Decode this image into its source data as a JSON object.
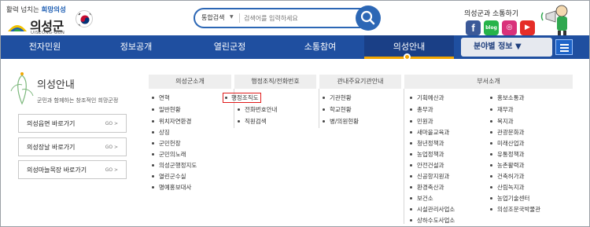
{
  "header": {
    "slogan_prefix": "활력 넘치는 ",
    "slogan_highlight": "희망의성",
    "logo_name": "의성군",
    "logo_sub": "UISEONG-GUN",
    "sns_title": "의성군과 소통하기",
    "sns": {
      "facebook": "f",
      "blog": "blog",
      "instagram": "◎",
      "youtube": "▶"
    }
  },
  "search": {
    "scope": "통합검색",
    "placeholder": "검색어를 입력하세요"
  },
  "nav": {
    "items": [
      "전자민원",
      "정보공개",
      "열린군정",
      "소통참여",
      "의성안내"
    ],
    "active_index": 4,
    "field_info": "분야별 정보 ▼"
  },
  "left_panel": {
    "title": "의성안내",
    "desc": "군민과 함께하는 창조적인 희망군정",
    "buttons": [
      {
        "label": "의성읍면 바로가기",
        "go": "GO >"
      },
      {
        "label": "의성장날 바로가기",
        "go": "GO >"
      },
      {
        "label": "의성마늘목장 바로가기",
        "go": "GO >"
      }
    ]
  },
  "columns": [
    {
      "header": "의성군소개",
      "items": [
        "연혁",
        "일반현황",
        "위치자연환경",
        "상징",
        "군민헌장",
        "군민의노래",
        "의성군행정지도",
        "열린군수실",
        "명예홍보대사"
      ]
    },
    {
      "header": "행정조직/전화번호",
      "items": [
        "행정조직도",
        "전화번호안내",
        "직원검색"
      ],
      "highlight_index": 0
    },
    {
      "header": "관내주요기관안내",
      "items": [
        "기관현황",
        "학교현황",
        "병/의원현황"
      ]
    },
    {
      "header": "부서소개",
      "items_left": [
        "기획예산과",
        "총무과",
        "민원과",
        "새마을교육과",
        "청년정책과",
        "농업정책과",
        "안전건설과",
        "신공항지원과",
        "환경축산과",
        "보건소",
        "시설관리사업소",
        "상하수도사업소"
      ],
      "items_right": [
        "홍보소통과",
        "재무과",
        "복지과",
        "관광문화과",
        "미래산업과",
        "유통정책과",
        "농촌활력과",
        "건축허가과",
        "산림녹지과",
        "농업기술센터",
        "의성조문국박물관"
      ]
    }
  ],
  "colors": {
    "nav": "#1f4fa0",
    "accent": "#f2a600",
    "highlight": "#e01b1b"
  }
}
